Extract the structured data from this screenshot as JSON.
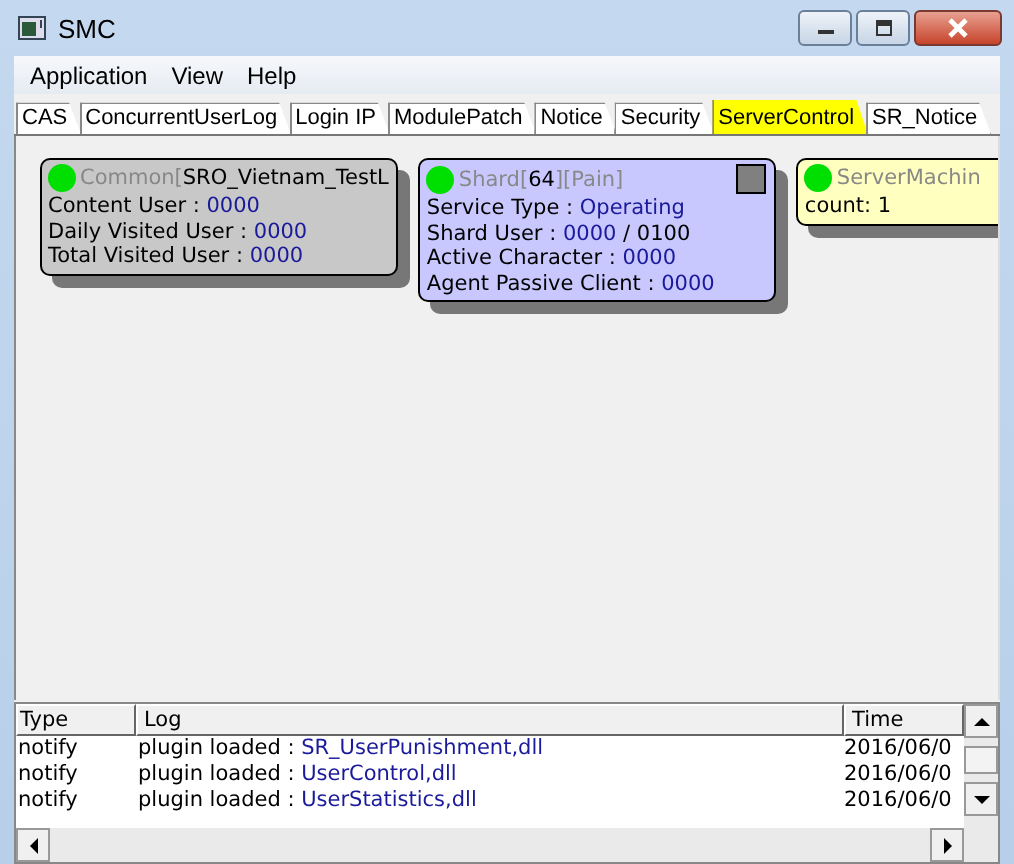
{
  "window": {
    "title": "SMC"
  },
  "menu": [
    "Application",
    "View",
    "Help"
  ],
  "tabs": [
    {
      "label": "CAS",
      "selected": false
    },
    {
      "label": "ConcurrentUserLog",
      "selected": false
    },
    {
      "label": "Login IP",
      "selected": false
    },
    {
      "label": "ModulePatch",
      "selected": false
    },
    {
      "label": "Notice",
      "selected": false
    },
    {
      "label": "Security",
      "selected": false
    },
    {
      "label": "ServerControl",
      "selected": true
    },
    {
      "label": "SR_Notice",
      "selected": false
    }
  ],
  "cards": [
    {
      "color": "#c8c8c8",
      "status_box": false,
      "title": [
        {
          "text": "Common[",
          "dim": true
        },
        {
          "text": "SRO_Vietnam_TestL",
          "dim": false
        }
      ],
      "lines": [
        [
          {
            "text": "Content User : ",
            "value": false
          },
          {
            "text": "0000",
            "value": true
          }
        ],
        [
          {
            "text": "Daily Visited User : ",
            "value": false
          },
          {
            "text": "0000",
            "value": true
          }
        ],
        [
          {
            "text": "Total Visited User : ",
            "value": false
          },
          {
            "text": "0000",
            "value": true
          }
        ]
      ]
    },
    {
      "color": "#c8c8ff",
      "status_box": true,
      "title": [
        {
          "text": "Shard[",
          "dim": true
        },
        {
          "text": "64",
          "dim": false
        },
        {
          "text": "][Pain]",
          "dim": true
        }
      ],
      "lines": [
        [
          {
            "text": "Service Type : ",
            "value": false
          },
          {
            "text": "Operating",
            "value": true
          }
        ],
        [
          {
            "text": "Shard User : ",
            "value": false
          },
          {
            "text": "0000",
            "value": true
          },
          {
            "text": " / 0100",
            "value": false
          }
        ],
        [
          {
            "text": "Active Character : ",
            "value": false
          },
          {
            "text": "0000",
            "value": true
          }
        ],
        [
          {
            "text": "Agent Passive Client : ",
            "value": false
          },
          {
            "text": "0000",
            "value": true
          }
        ]
      ]
    },
    {
      "color": "#ffffc0",
      "status_box": false,
      "title": [
        {
          "text": "ServerMachin",
          "dim": true
        }
      ],
      "lines": [
        [
          {
            "text": "count: 1",
            "value": false
          }
        ]
      ]
    }
  ],
  "log": {
    "columns": [
      "Type",
      "Log",
      "Time"
    ],
    "rows": [
      {
        "type": "notify",
        "prefix": "plugin loaded : ",
        "name": "SR_UserPunishment,dll",
        "time": "2016/06/0"
      },
      {
        "type": "notify",
        "prefix": "plugin loaded : ",
        "name": "UserControl,dll",
        "time": "2016/06/0"
      },
      {
        "type": "notify",
        "prefix": "plugin loaded : ",
        "name": "UserStatistics,dll",
        "time": "2016/06/0"
      }
    ]
  }
}
